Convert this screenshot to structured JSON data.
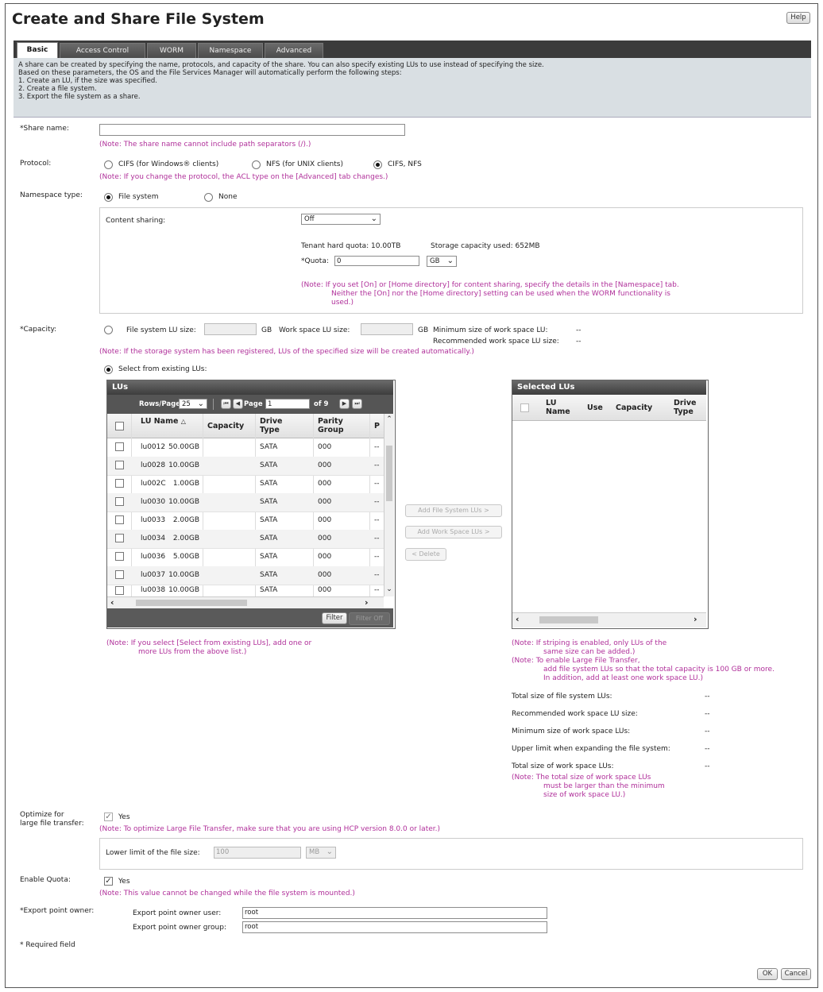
{
  "dialog": {
    "title": "Create and Share File System",
    "help_label": "Help",
    "ok_label": "OK",
    "cancel_label": "Cancel"
  },
  "tabs": [
    "Basic",
    "Access Control",
    "WORM",
    "Namespace",
    "Advanced"
  ],
  "intro": [
    "A share can be created by specifying the name, protocols, and capacity of the share. You can also specify existing LUs to use instead of specifying the size.",
    "Based on these parameters, the OS and the File Services Manager will automatically perform the following steps:",
    "1. Create an LU, if the size was specified.",
    "2. Create a file system.",
    "3. Export the file system as a share."
  ],
  "share_name": {
    "label": "*Share name:",
    "value": "",
    "note": "(Note: The share name cannot include path separators (/).)"
  },
  "protocol": {
    "label": "Protocol:",
    "options": [
      "CIFS (for Windows® clients)",
      "NFS (for UNIX clients)",
      "CIFS, NFS"
    ],
    "selected_index": 2,
    "note": "(Note: If you change the protocol, the ACL type on the [Advanced] tab changes.)"
  },
  "namespace_type": {
    "label": "Namespace type:",
    "options": [
      "File system",
      "None"
    ],
    "selected_index": 0,
    "content_sharing_label": "Content sharing:",
    "content_sharing_value": "Off",
    "tenant_quota": "Tenant hard quota: 10.00TB",
    "storage_used": "Storage capacity used: 652MB",
    "quota_label": "*Quota:",
    "quota_value": "0",
    "quota_unit": "GB",
    "note_lines": [
      "(Note: If you set [On] or [Home directory] for content sharing, specify the details in the [Namespace] tab.",
      "Neither the [On] nor the [Home directory] setting can be used when the WORM functionality is",
      "used.)"
    ]
  },
  "capacity": {
    "label": "*Capacity:",
    "fs_lu_size_label": "File system LU size:",
    "unit1": "GB",
    "ws_lu_size_label": "Work space LU size:",
    "unit2": "GB",
    "min_ws_label": "Minimum size of work space LU:",
    "min_ws_value": "--",
    "rec_ws_label": "Recommended work space LU size:",
    "rec_ws_value": "--",
    "note": "(Note: If the storage system has been registered, LUs of the specified size will be created automatically.)",
    "existing_label": "Select from existing LUs:"
  },
  "lus_grid": {
    "title": "LUs",
    "rows_per_page_label": "Rows/Page:",
    "rows_per_page": "25",
    "page_label": "Page",
    "page_value": "1",
    "of_pages": "of 9",
    "columns": [
      "LU Name",
      "Capacity",
      "Drive Type",
      "Parity Group",
      "P"
    ],
    "rows": [
      [
        "lu0012",
        "50.00GB",
        "SATA",
        "000",
        "--"
      ],
      [
        "lu0028",
        "10.00GB",
        "SATA",
        "000",
        "--"
      ],
      [
        "lu002C",
        "1.00GB",
        "SATA",
        "000",
        "--"
      ],
      [
        "lu0030",
        "10.00GB",
        "SATA",
        "000",
        "--"
      ],
      [
        "lu0033",
        "2.00GB",
        "SATA",
        "000",
        "--"
      ],
      [
        "lu0034",
        "2.00GB",
        "SATA",
        "000",
        "--"
      ],
      [
        "lu0036",
        "5.00GB",
        "SATA",
        "000",
        "--"
      ],
      [
        "lu0037",
        "10.00GB",
        "SATA",
        "000",
        "--"
      ],
      [
        "lu0038",
        "10.00GB",
        "SATA",
        "000",
        "--"
      ]
    ],
    "filter_label": "Filter",
    "filter_off_label": "Filter Off",
    "note_lines": [
      "(Note: If you select [Select from existing LUs], add one or",
      "more LUs from the above list.)"
    ]
  },
  "mid_buttons": [
    "Add File System LUs >",
    "Add Work Space LUs >",
    "< Delete"
  ],
  "selected_grid": {
    "title": "Selected LUs",
    "columns": [
      "LU Name",
      "Use",
      "Capacity",
      "Drive Type"
    ],
    "note_lines": [
      "(Note: If striping is enabled, only LUs of the",
      "same size can be added.)",
      "(Note: To enable Large File Transfer,",
      "add file system LUs so that the total capacity is 100 GB or more.",
      "In addition, add at least one work space LU.)"
    ],
    "totals": [
      {
        "label": "Total size of file system LUs:",
        "value": "--"
      },
      {
        "label": "Recommended work space LU size:",
        "value": "--"
      },
      {
        "label": "Minimum size of work space LUs:",
        "value": "--"
      },
      {
        "label": "Upper limit when expanding the file system:",
        "value": "--"
      },
      {
        "label": "Total size of work space LUs:",
        "value": "--"
      }
    ],
    "ws_note_lines": [
      "(Note: The total size of work space LUs",
      "must be larger than the minimum",
      "size of work space LU.)"
    ]
  },
  "optimize": {
    "label_line1": "Optimize for",
    "label_line2": "large file transfer:",
    "yes_label": "Yes",
    "note": "(Note: To optimize Large File Transfer, make sure that you are using HCP version 8.0.0 or later.)",
    "lower_limit_label": "Lower limit of the file size:",
    "lower_limit_value": "100",
    "lower_limit_unit": "MB"
  },
  "enable_quota": {
    "label": "Enable Quota:",
    "yes_label": "Yes",
    "note": "(Note: This value cannot be changed while the file system is mounted.)"
  },
  "export_owner": {
    "label": "*Export point owner:",
    "user_label": "Export point owner user:",
    "user_value": "root",
    "group_label": "Export point owner group:",
    "group_value": "root"
  },
  "required_note": "* Required field"
}
